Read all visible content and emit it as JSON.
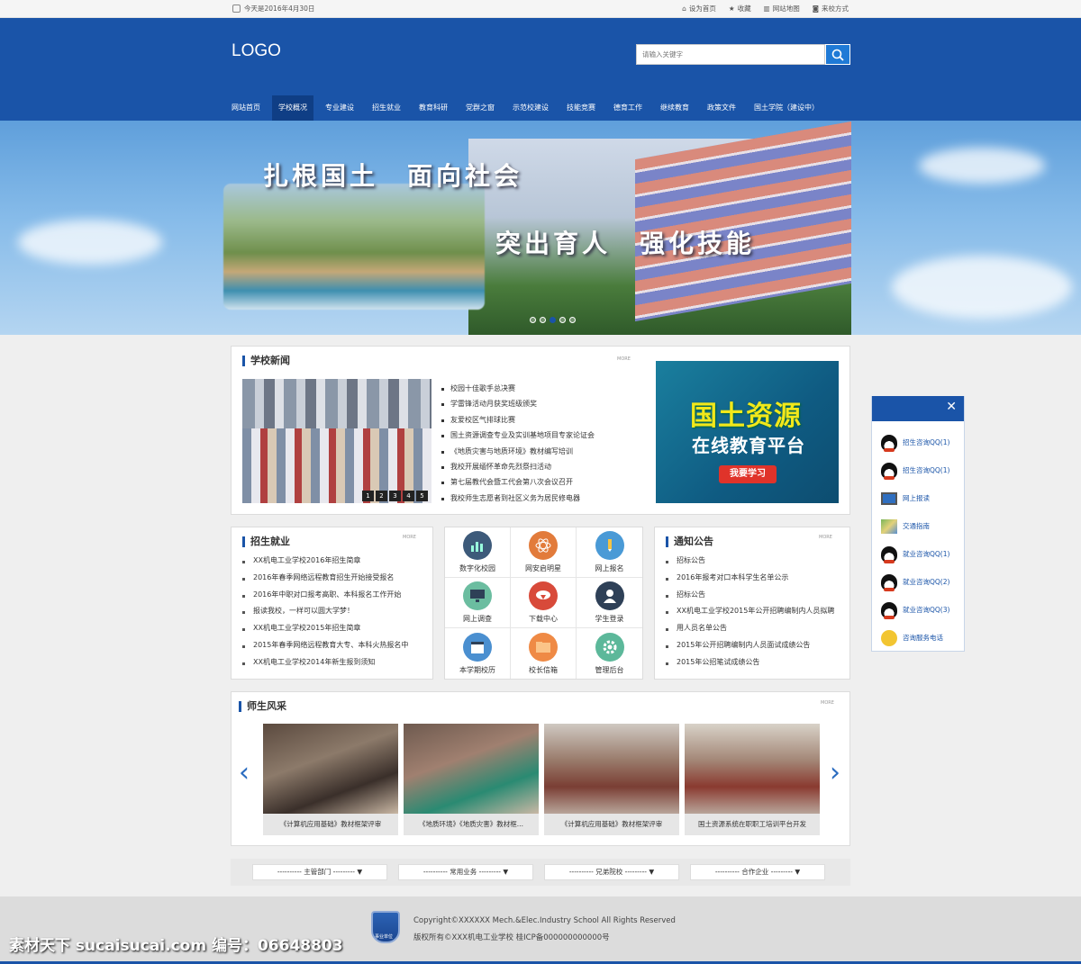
{
  "topbar": {
    "date": "今天是2016年4月30日",
    "links": [
      "设为首页",
      "收藏",
      "网站地图",
      "来校方式"
    ]
  },
  "header": {
    "logo": "LOGO",
    "search_placeholder": "请输入关键字",
    "nav": [
      "网站首页",
      "学校概况",
      "专业建设",
      "招生就业",
      "教育科研",
      "党群之窗",
      "示范校建设",
      "技能竞赛",
      "德育工作",
      "继续教育",
      "政策文件",
      "国土学院（建设中）"
    ],
    "nav_active": "学校概况"
  },
  "banner": {
    "line1": "扎根国土　面向社会",
    "line2": "突出育人　强化技能",
    "slide_count": 5,
    "active_slide": 2
  },
  "news": {
    "title": "学校新闻",
    "more": "MORE",
    "pages": [
      "1",
      "2",
      "3",
      "4",
      "5"
    ],
    "items": [
      "校园十佳歌手总决赛",
      "学雷锋活动月获奖班级颁奖",
      "友爱校区气排球比赛",
      "国土资源调查专业及实训基地项目专家论证会",
      "《地质灾害与地质环境》教材编写培训",
      "我校开展缅怀革命先烈祭扫活动",
      "第七届教代会暨工代会第八次会议召开",
      "我校师生志愿者到社区义务为居民修电器"
    ],
    "ad": {
      "line1": "国土资源",
      "line2": "在线教育平台",
      "button": "我要学习"
    }
  },
  "enroll": {
    "title": "招生就业",
    "more": "MORE",
    "items": [
      "XX机电工业学校2016年招生简章",
      "2016年春季网络远程教育招生开始接受报名",
      "2016年中职对口报考高职、本科报名工作开始",
      "报读我校，一样可以圆大学梦！",
      "XX机电工业学校2015年招生简章",
      "2015年春季网络远程教育大专、本科火热报名中",
      "XX机电工业学校2014年新生报到须知"
    ]
  },
  "services": [
    {
      "label": "数字化校园",
      "icon": "bar-chart-icon",
      "color": "#3d5a7a"
    },
    {
      "label": "网安启明星",
      "icon": "atom-icon",
      "color": "#e27b3b"
    },
    {
      "label": "网上报名",
      "icon": "pencil-icon",
      "color": "#4a9ad6"
    },
    {
      "label": "网上调查",
      "icon": "monitor-icon",
      "color": "#6bbda0"
    },
    {
      "label": "下载中心",
      "icon": "download-cloud-icon",
      "color": "#d84a3a"
    },
    {
      "label": "学生登录",
      "icon": "user-icon",
      "color": "#2e4057"
    },
    {
      "label": "本学期校历",
      "icon": "calendar-icon",
      "color": "#4a8fd0"
    },
    {
      "label": "校长信箱",
      "icon": "folder-icon",
      "color": "#ef8a45"
    },
    {
      "label": "管理后台",
      "icon": "gear-icon",
      "color": "#5cb89a"
    }
  ],
  "notice": {
    "title": "通知公告",
    "more": "MORE",
    "items": [
      "招标公告",
      "2016年报考对口本科学生名单公示",
      "招标公告",
      "XX机电工业学校2015年公开招聘编制内人员拟聘",
      "用人员名单公告",
      "2015年公开招聘编制内人员面试成绩公告",
      "2015年公招笔试成绩公告"
    ]
  },
  "gallery": {
    "title": "师生风采",
    "more": "MORE",
    "items": [
      "《计算机应用基础》教材框架评审",
      "《地质环境》《地质灾害》教材框...",
      "《计算机应用基础》教材框架评审",
      "国土资源系统在职职工培训平台开发"
    ]
  },
  "linkbar": [
    "主管部门",
    "常用业务",
    "兄弟院校",
    "合作企业"
  ],
  "footer": {
    "copyright": "Copyright©XXXXXX Mech.&Elec.Industry School All Rights Reserved",
    "icp": "版权所有©XXX机电工业学校 桂ICP备000000000000号",
    "badge": "事业单位"
  },
  "watermark": "素材天下 sucaisucai.com  编号：06648803",
  "side": {
    "items": [
      {
        "label": "招生咨询QQ(1)",
        "icon": "qq-penguin-icon"
      },
      {
        "label": "招生咨询QQ(1)",
        "icon": "qq-penguin-icon"
      },
      {
        "label": "网上报读",
        "icon": "computer-icon"
      },
      {
        "label": "交通指南",
        "icon": "map-icon"
      },
      {
        "label": "就业咨询QQ(1)",
        "icon": "qq-penguin-icon"
      },
      {
        "label": "就业咨询QQ(2)",
        "icon": "qq-penguin-icon"
      },
      {
        "label": "就业咨询QQ(3)",
        "icon": "qq-penguin-icon"
      },
      {
        "label": "咨询服务电话",
        "icon": "phone-smiley-icon"
      }
    ]
  }
}
